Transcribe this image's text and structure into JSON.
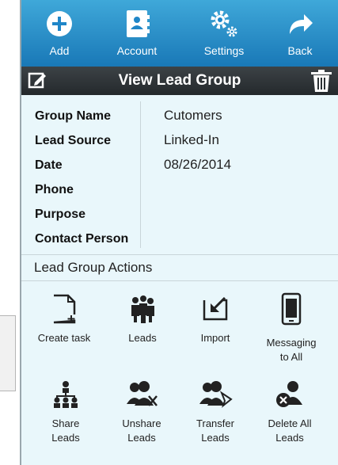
{
  "toolbar": {
    "add_label": "Add",
    "account_label": "Account",
    "settings_label": "Settings",
    "back_label": "Back"
  },
  "titlebar": {
    "title": "View Lead Group"
  },
  "details": {
    "group_name_label": "Group Name",
    "group_name_value": "Cutomers",
    "lead_source_label": "Lead Source",
    "lead_source_value": "Linked-In",
    "date_label": "Date",
    "date_value": "08/26/2014",
    "phone_label": "Phone",
    "purpose_label": "Purpose",
    "contact_person_label": "Contact Person"
  },
  "actions": {
    "header": "Lead Group Actions",
    "create_task": "Create task",
    "leads": "Leads",
    "import": "Import",
    "messaging_line1": "Messaging",
    "messaging_line2": "to All",
    "share_line1": "Share",
    "share_line2": "Leads",
    "unshare_line1": "Unshare",
    "unshare_line2": "Leads",
    "transfer_line1": "Transfer",
    "transfer_line2": "Leads",
    "delete_line1": "Delete All",
    "delete_line2": "Leads"
  },
  "icons": {
    "toolbar": [
      "plus-circle-icon",
      "address-book-icon",
      "gears-icon",
      "share-arrow-icon"
    ],
    "titlebar": [
      "edit-icon",
      "trash-icon"
    ],
    "actions": [
      "new-document-icon",
      "people-icon",
      "import-icon",
      "mobile-phone-icon",
      "share-hierarchy-icon",
      "unshare-people-icon",
      "transfer-people-icon",
      "delete-people-icon"
    ]
  },
  "colors": {
    "toolbar": "#1f86c8",
    "titlebar": "#2b3134",
    "panel_bg": "#e9f7fb"
  }
}
